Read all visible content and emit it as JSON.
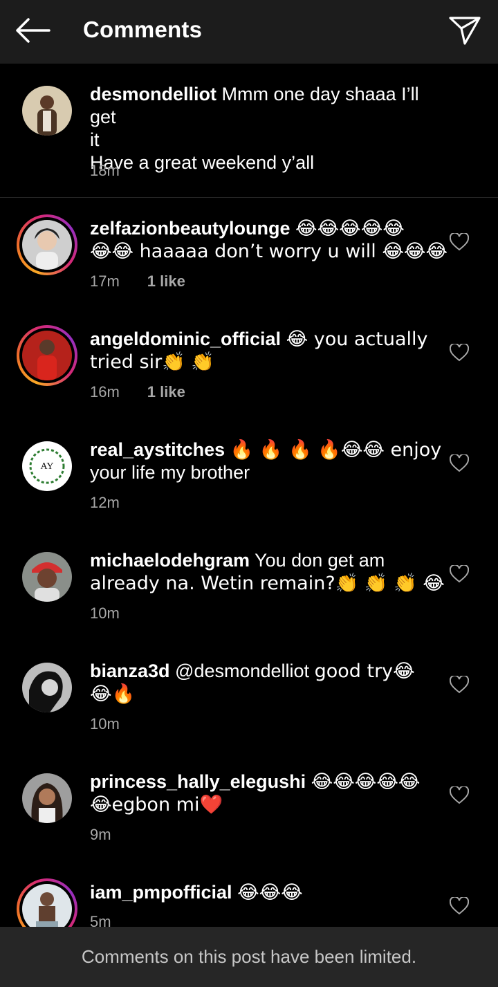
{
  "header": {
    "title": "Comments"
  },
  "caption": {
    "username": "desmondelliot",
    "text_line1": "Mmm one day shaaa I’ll get",
    "text_line2": "it",
    "text_line3": "Have a great weekend y’all",
    "time": "18m"
  },
  "comments": [
    {
      "username": "zelfazionbeautylounge",
      "emoji1": "😂😂😂😂😂",
      "line2": "😂😂 haaaaa don’t worry u will 😂😂😂",
      "time": "17m",
      "likes": "1 like"
    },
    {
      "username": "angeldominic_official",
      "line1": "😂 you actually",
      "line2": "tried sir👏 👏",
      "time": "16m",
      "likes": "1 like"
    },
    {
      "username": "real_aystitches",
      "line1": "🔥 🔥 🔥 🔥😂😂 enjoy",
      "line2": "your life my brother",
      "time": "12m"
    },
    {
      "username": "michaelodehgram",
      "line1": "You don get am",
      "line2": "already na. Wetin remain?👏 👏 👏 😂",
      "time": "10m"
    },
    {
      "username": "bianza3d",
      "mention": "@desmondelliot",
      "line1": "good try😂",
      "line2": "😂🔥",
      "time": "10m"
    },
    {
      "username": "princess_hally_elegushi",
      "line1": "😂😂😂😂😂",
      "line2": "😂egbon mi❤️",
      "time": "9m"
    },
    {
      "username": "iam_pmpofficial",
      "line1": "😂😂😂",
      "time": "5m"
    }
  ],
  "footer": {
    "text": "Comments on this post have been limited."
  },
  "colors": {
    "background": "#000000",
    "header": "#1c1c1c",
    "meta": "#a8a8a8",
    "footer": "#262626"
  }
}
